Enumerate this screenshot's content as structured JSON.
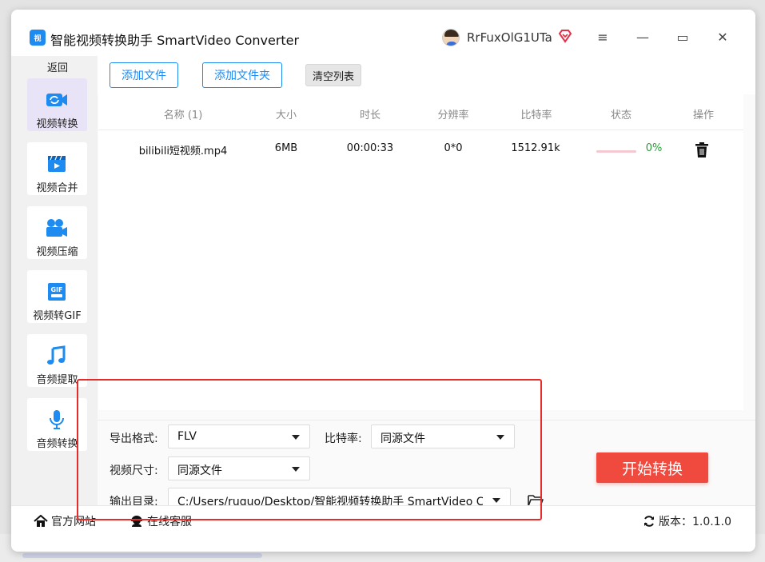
{
  "app": {
    "title": "智能视频转换助手 SmartVideo Converter",
    "logo_text": "视",
    "username": "RrFuxOlG1UTa"
  },
  "window_controls": {
    "menu": "≡",
    "minimize": "—",
    "maximize": "▭",
    "close": "✕"
  },
  "sidebar": {
    "back_label": "返回",
    "items": [
      {
        "label": "视频转换",
        "icon": "video-convert-icon",
        "active": true
      },
      {
        "label": "视频合并",
        "icon": "video-merge-icon",
        "active": false
      },
      {
        "label": "视频压缩",
        "icon": "video-compress-icon",
        "active": false
      },
      {
        "label": "视频转GIF",
        "icon": "gif-icon",
        "active": false
      },
      {
        "label": "音频提取",
        "icon": "music-note-icon",
        "active": false
      },
      {
        "label": "音频转换",
        "icon": "microphone-icon",
        "active": false
      }
    ]
  },
  "toolbar": {
    "add_file": "添加文件",
    "add_folder": "添加文件夹",
    "clear_list": "清空列表"
  },
  "table": {
    "columns": [
      "名称 (1)",
      "大小",
      "时长",
      "分辨率",
      "比特率",
      "状态",
      "操作"
    ],
    "rows": [
      {
        "name": "bilibili短视频.mp4",
        "size": "6MB",
        "duration": "00:00:33",
        "resolution": "0*0",
        "bitrate": "1512.91k",
        "progress": 0,
        "progress_text": "0%"
      }
    ]
  },
  "settings": {
    "format_label": "导出格式:",
    "format_value": "FLV",
    "bitrate_label": "比特率:",
    "bitrate_value": "同源文件",
    "size_label": "视频尺寸:",
    "size_value": "同源文件",
    "output_label": "输出目录:",
    "output_value": "C:/Users/ruguo/Desktop/智能视频转换助手 SmartVideo Converter"
  },
  "start_button": "开始转换",
  "footer": {
    "website": "官方网站",
    "support": "在线客服",
    "version": "版本：1.0.1.0"
  },
  "colors": {
    "accent": "#1e8bf0",
    "start": "#f0493e",
    "highlight": "#e62b2b",
    "progress_text": "#2a9d3c"
  }
}
